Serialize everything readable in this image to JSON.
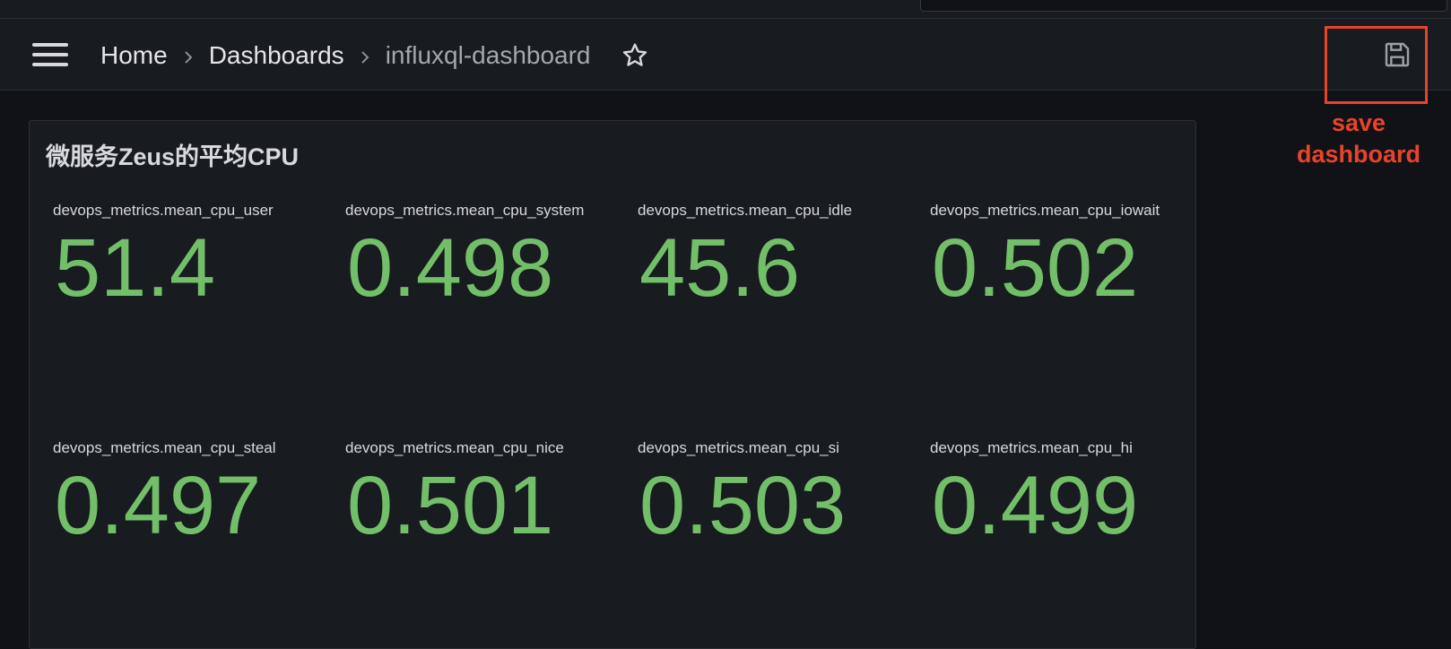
{
  "breadcrumb": {
    "home": "Home",
    "dashboards": "Dashboards",
    "current": "influxql-dashboard"
  },
  "icons": {
    "menu": "hamburger-menu-icon",
    "separator": "chevron-right-icon",
    "star": "star-icon",
    "save": "floppy-disk-icon",
    "logo": "grafana-logo-icon"
  },
  "annotation": {
    "line1": "save",
    "line2": "dashboard"
  },
  "panel": {
    "title": "微服务Zeus的平均CPU",
    "stats": [
      {
        "label": "devops_metrics.mean_cpu_user",
        "value": "51.4"
      },
      {
        "label": "devops_metrics.mean_cpu_system",
        "value": "0.498"
      },
      {
        "label": "devops_metrics.mean_cpu_idle",
        "value": "45.6"
      },
      {
        "label": "devops_metrics.mean_cpu_iowait",
        "value": "0.502"
      },
      {
        "label": "devops_metrics.mean_cpu_steal",
        "value": "0.497"
      },
      {
        "label": "devops_metrics.mean_cpu_nice",
        "value": "0.501"
      },
      {
        "label": "devops_metrics.mean_cpu_si",
        "value": "0.503"
      },
      {
        "label": "devops_metrics.mean_cpu_hi",
        "value": "0.499"
      }
    ]
  },
  "colors": {
    "background": "#111217",
    "panel": "#181b1f",
    "value_green": "#73bf69",
    "annotation_red": "#e8442a",
    "logo_yellow": "#f2b61d"
  }
}
